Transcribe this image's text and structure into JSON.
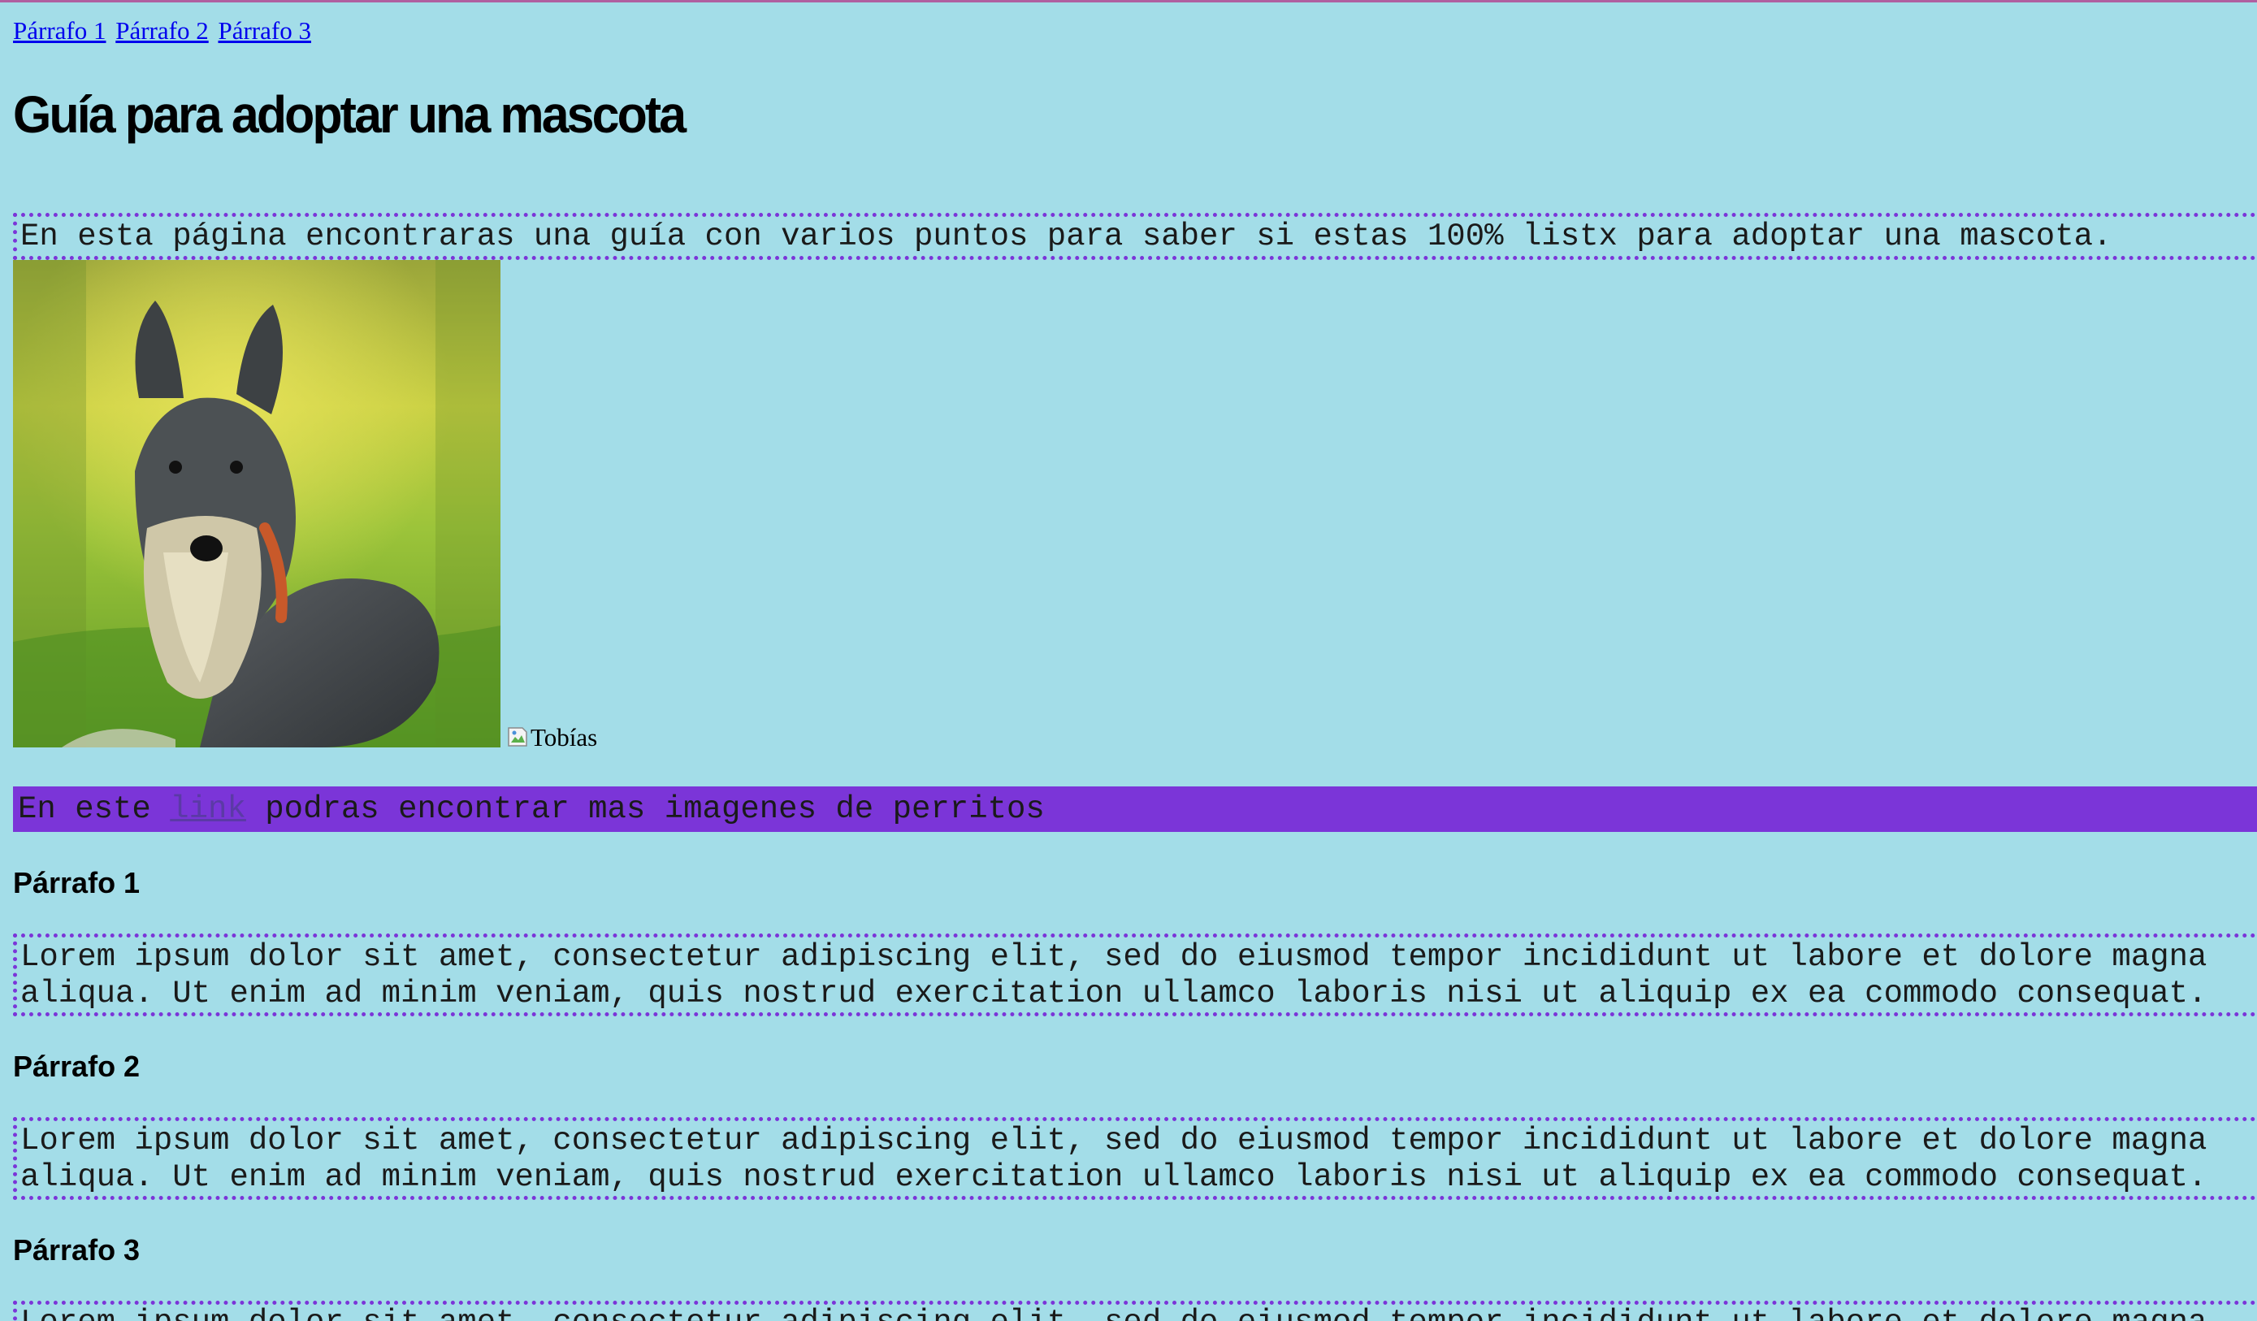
{
  "nav": {
    "links": [
      "Párrafo 1",
      "Párrafo 2",
      "Párrafo 3"
    ]
  },
  "header": {
    "title": "Guía para adoptar una mascota"
  },
  "intro": {
    "text": "En esta página encontraras una guía con varios puntos para saber si estas 100% listx para adoptar una mascota."
  },
  "images": {
    "broken_alt": "Tobías"
  },
  "banner": {
    "before": "En este ",
    "link_label": "link",
    "after": " podras encontrar mas imagenes de perritos"
  },
  "sections": [
    {
      "heading": "Párrafo 1",
      "line1": "Lorem ipsum dolor sit amet, consectetur adipiscing elit, sed do eiusmod tempor incididunt ut labore et dolore magna",
      "line2": "aliqua. Ut enim ad minim veniam, quis nostrud exercitation ullamco laboris nisi ut aliquip ex ea commodo consequat."
    },
    {
      "heading": "Párrafo 2",
      "line1": "Lorem ipsum dolor sit amet, consectetur adipiscing elit, sed do eiusmod tempor incididunt ut labore et dolore magna",
      "line2": "aliqua. Ut enim ad minim veniam, quis nostrud exercitation ullamco laboris nisi ut aliquip ex ea commodo consequat."
    },
    {
      "heading": "Párrafo 3",
      "line1": "Lorem ipsum dolor sit amet, consectetur adipiscing elit, sed do eiusmod tempor incididunt ut labore et dolore magna"
    }
  ],
  "colors": {
    "background": "#a3dde8",
    "accent": "#7b35d8",
    "link": "#0000ee"
  }
}
